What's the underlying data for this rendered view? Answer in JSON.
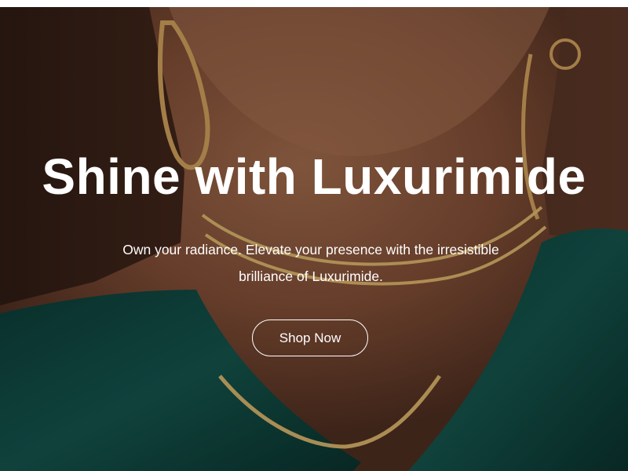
{
  "hero": {
    "title": "Shine with Luxurimide",
    "subtitle": "Own your radiance. Elevate your presence with the irresistible brilliance of Luxurimide.",
    "cta_label": "Shop Now",
    "background_image": "woman-wearing-gold-necklaces-and-earrings",
    "colors": {
      "text": "#ffffff",
      "skin_tone": "#8a5a3f",
      "background": "#3a2418",
      "garment": "#12463f",
      "gold": "#d8b36a"
    }
  }
}
